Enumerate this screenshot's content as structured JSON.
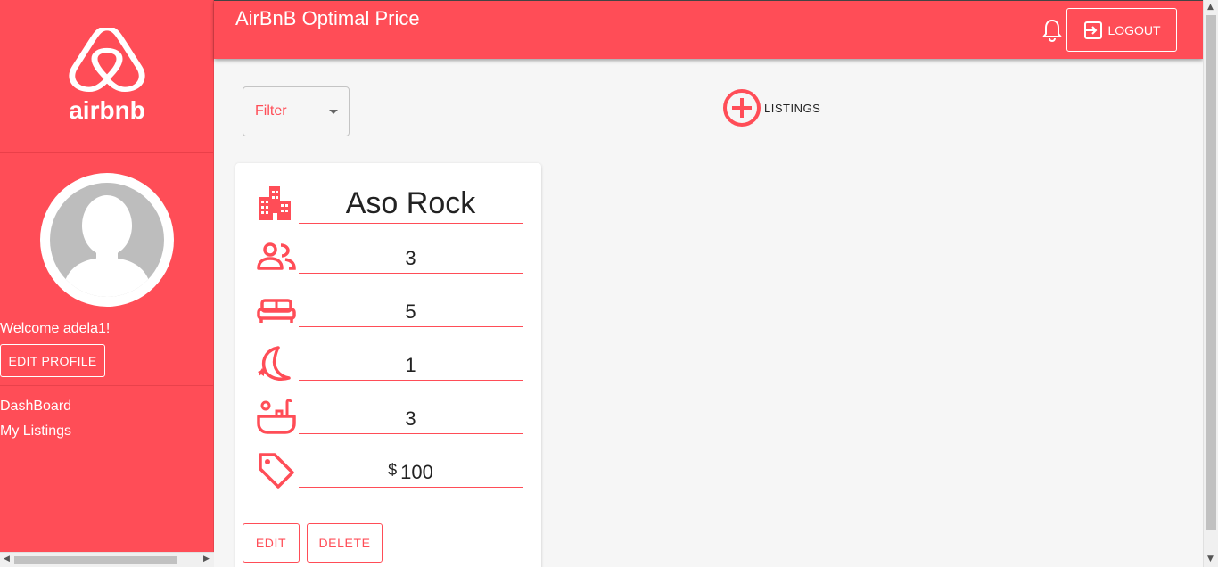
{
  "header": {
    "title": "AirBnB Optimal Price",
    "logout_label": "LOGOUT",
    "bell_icon": "bell-icon",
    "logout_icon": "exit-to-app-icon"
  },
  "sidebar": {
    "logo_text": "airbnb",
    "welcome": "Welcome adela1!",
    "edit_profile_label": "EDIT PROFILE",
    "nav": [
      {
        "label": "DashBoard"
      },
      {
        "label": "My Listings"
      }
    ]
  },
  "toolbar": {
    "filter_label": "Filter",
    "add_listing_label": "LISTINGS",
    "add_icon": "add-circle-icon"
  },
  "listing": {
    "name": "Aso Rock",
    "guests": "3",
    "beds": "5",
    "min_nights": "1",
    "bathrooms": "3",
    "currency": "$",
    "price": "100",
    "edit_label": "EDIT",
    "delete_label": "DELETE"
  },
  "colors": {
    "brand": "#ff4d57",
    "background": "#f6f6f6",
    "card": "#ffffff"
  }
}
